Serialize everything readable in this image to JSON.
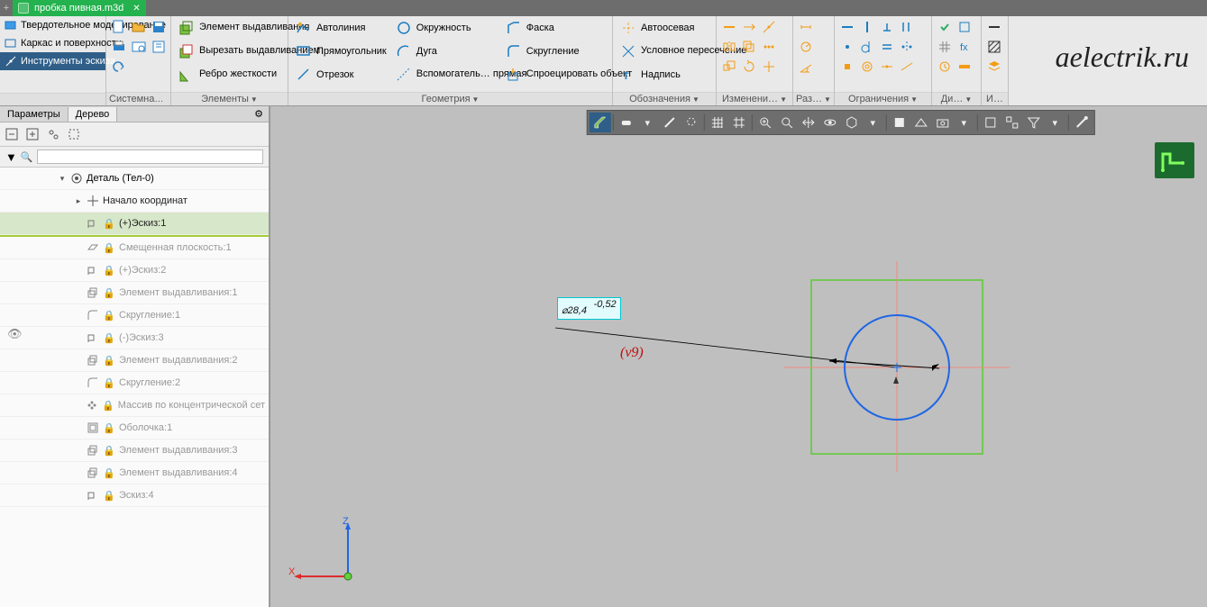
{
  "tab": {
    "title": "пробка пивная.m3d"
  },
  "sidemenu": {
    "items": [
      {
        "label": "Твердотельное моделирование"
      },
      {
        "label": "Каркас и поверхности"
      },
      {
        "label": "Инструменты эскиза"
      }
    ]
  },
  "ribbon_labels": {
    "system": "Системная",
    "elements": "Элементы",
    "geometry": "Геометрия",
    "annotations": "Обозначения",
    "edit": "Изменени…",
    "dims": "Раз…",
    "constraints": "Ограничения",
    "diag": "Ди…",
    "fmt": "И…"
  },
  "features": {
    "extrude": "Элемент выдавливания",
    "cut": "Вырезать выдавливанием",
    "rib": "Ребро жесткости",
    "autoline": "Автолиния",
    "rectangle": "Прямоугольник",
    "segment": "Отрезок",
    "circle": "Окружность",
    "arc": "Дуга",
    "auxline": "Вспомогатель… прямая",
    "chamfer": "Фаска",
    "fillet": "Скругление",
    "project": "Спроецировать объект",
    "autoaxis": "Автоосевая",
    "condint": "Условное пересечение",
    "text": "Надпись"
  },
  "watermark": "aelectrik.ru",
  "panel": {
    "params": "Параметры",
    "tree": "Дерево"
  },
  "tree": {
    "root": "Деталь (Тел-0)",
    "items": [
      {
        "label": "Начало координат",
        "depth": 1,
        "icon": "origin",
        "tw": "▸"
      },
      {
        "label": "(+)Эскиз:1",
        "depth": 1,
        "icon": "sketch",
        "lock": true,
        "sel": true
      },
      {
        "label": "Смещенная плоскость:1",
        "depth": 1,
        "icon": "plane",
        "lock": true,
        "dim": true
      },
      {
        "label": "(+)Эскиз:2",
        "depth": 1,
        "icon": "sketch",
        "lock": true,
        "dim": true
      },
      {
        "label": "Элемент выдавливания:1",
        "depth": 1,
        "icon": "extrude",
        "lock": true,
        "dim": true
      },
      {
        "label": "Скругление:1",
        "depth": 1,
        "icon": "fillet",
        "lock": true,
        "dim": true
      },
      {
        "label": "(-)Эскиз:3",
        "depth": 1,
        "icon": "sketch",
        "lock": true,
        "dim": true
      },
      {
        "label": "Элемент выдавливания:2",
        "depth": 1,
        "icon": "extrude",
        "lock": true,
        "dim": true
      },
      {
        "label": "Скругление:2",
        "depth": 1,
        "icon": "fillet",
        "lock": true,
        "dim": true
      },
      {
        "label": "Массив по концентрической сет",
        "depth": 1,
        "icon": "pattern",
        "lock": true,
        "dim": true
      },
      {
        "label": "Оболочка:1",
        "depth": 1,
        "icon": "shell",
        "lock": true,
        "dim": true
      },
      {
        "label": "Элемент выдавливания:3",
        "depth": 1,
        "icon": "extrude",
        "lock": true,
        "dim": true
      },
      {
        "label": "Элемент выдавливания:4",
        "depth": 1,
        "icon": "extrude",
        "lock": true,
        "dim": true
      },
      {
        "label": "Эскиз:4",
        "depth": 1,
        "icon": "sketch",
        "lock": true,
        "dim": true
      }
    ]
  },
  "sketch": {
    "dim_value": "⌀28,4",
    "dim_tol": "-0,52",
    "dim_ref": "(v9)"
  },
  "axes": {
    "x": "X",
    "z": "Z"
  }
}
